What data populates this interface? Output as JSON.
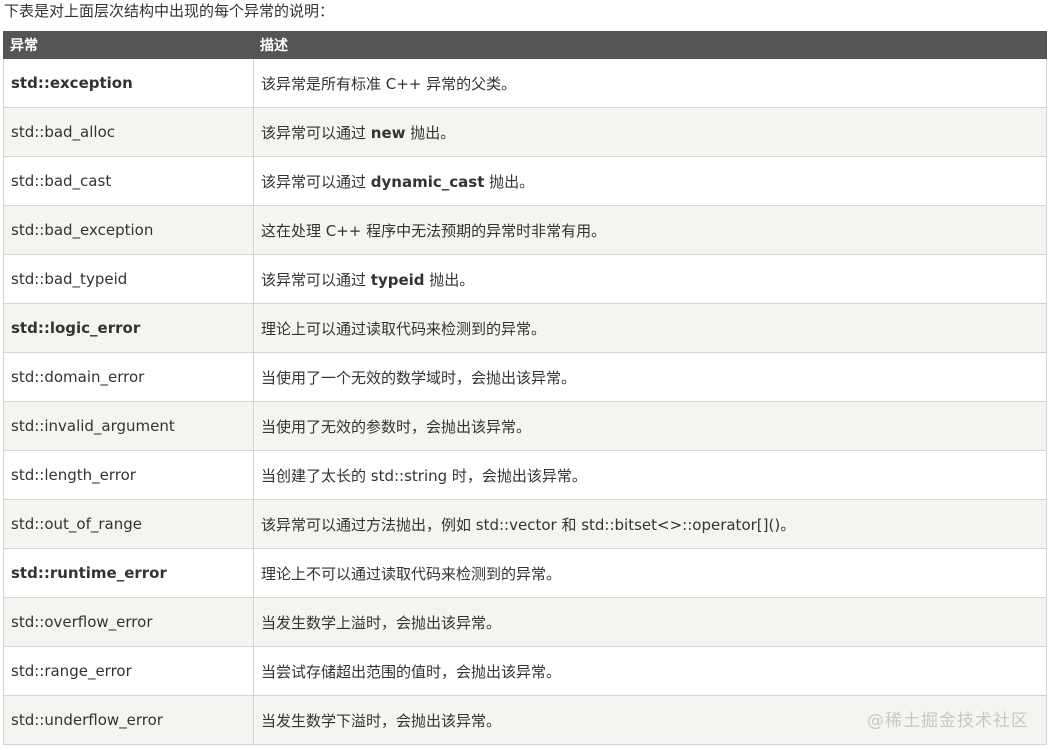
{
  "intro": "下表是对上面层次结构中出现的每个异常的说明：",
  "table": {
    "headers": [
      "异常",
      "描述"
    ],
    "rows": [
      {
        "name": "std::exception",
        "bold": true,
        "pre": "该异常是所有标准 C++ 异常的父类。",
        "code": "",
        "post": ""
      },
      {
        "name": "std::bad_alloc",
        "bold": false,
        "pre": "该异常可以通过 ",
        "code": "new",
        "post": " 抛出。"
      },
      {
        "name": "std::bad_cast",
        "bold": false,
        "pre": "该异常可以通过 ",
        "code": "dynamic_cast",
        "post": " 抛出。"
      },
      {
        "name": "std::bad_exception",
        "bold": false,
        "pre": "这在处理 C++ 程序中无法预期的异常时非常有用。",
        "code": "",
        "post": ""
      },
      {
        "name": "std::bad_typeid",
        "bold": false,
        "pre": "该异常可以通过 ",
        "code": "typeid",
        "post": " 抛出。"
      },
      {
        "name": "std::logic_error",
        "bold": true,
        "pre": "理论上可以通过读取代码来检测到的异常。",
        "code": "",
        "post": ""
      },
      {
        "name": "std::domain_error",
        "bold": false,
        "pre": "当使用了一个无效的数学域时，会抛出该异常。",
        "code": "",
        "post": ""
      },
      {
        "name": "std::invalid_argument",
        "bold": false,
        "pre": "当使用了无效的参数时，会抛出该异常。",
        "code": "",
        "post": ""
      },
      {
        "name": "std::length_error",
        "bold": false,
        "pre": "当创建了太长的 std::string 时，会抛出该异常。",
        "code": "",
        "post": ""
      },
      {
        "name": "std::out_of_range",
        "bold": false,
        "pre": "该异常可以通过方法抛出，例如 std::vector 和 std::bitset<>::operator[]()。",
        "code": "",
        "post": ""
      },
      {
        "name": "std::runtime_error",
        "bold": true,
        "pre": "理论上不可以通过读取代码来检测到的异常。",
        "code": "",
        "post": ""
      },
      {
        "name": "std::overflow_error",
        "bold": false,
        "pre": "当发生数学上溢时，会抛出该异常。",
        "code": "",
        "post": ""
      },
      {
        "name": "std::range_error",
        "bold": false,
        "pre": "当尝试存储超出范围的值时，会抛出该异常。",
        "code": "",
        "post": ""
      },
      {
        "name": "std::underflow_error",
        "bold": false,
        "pre": "当发生数学下溢时，会抛出该异常。",
        "code": "",
        "post": ""
      }
    ]
  },
  "watermark": "@稀土掘金技术社区"
}
